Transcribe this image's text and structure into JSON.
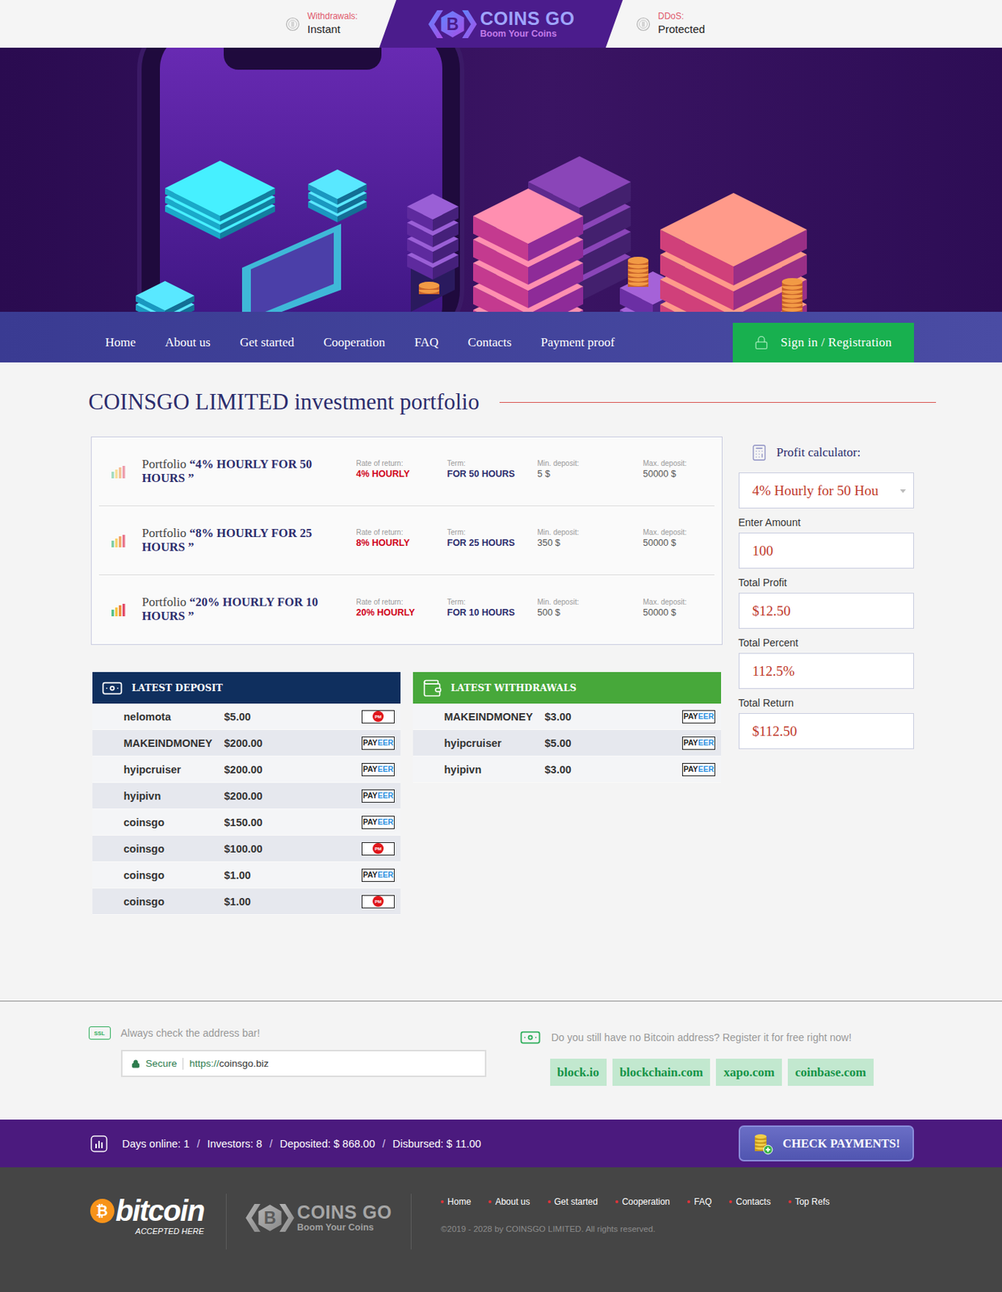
{
  "header": {
    "withdrawals": {
      "label": "Withdrawals:",
      "value": "Instant"
    },
    "ddos": {
      "label": "DDoS:",
      "value": "Protected"
    }
  },
  "logo": {
    "mark": "B",
    "name": "COINS GO",
    "tagline": "Boom Your Coins"
  },
  "nav": {
    "items": [
      "Home",
      "About us",
      "Get started",
      "Cooperation",
      "FAQ",
      "Contacts",
      "Payment proof"
    ],
    "sign_in": "Sign in / Registration"
  },
  "portfolio": {
    "title": "COINSGO LIMITED investment portfolio",
    "prefix": "Portfolio",
    "plans": [
      {
        "name": "“4% HOURLY FOR 50 HOURS ”",
        "rate_label": "Rate of return:",
        "rate": "4% HOURLY",
        "term_label": "Term:",
        "term": "FOR 50 HOURS",
        "min_label": "Min. deposit:",
        "min": "5 $",
        "max_label": "Max. deposit:",
        "max": "50000 $",
        "level": 0.33
      },
      {
        "name": "“8% HOURLY FOR 25 HOURS ”",
        "rate_label": "Rate of return:",
        "rate": "8% HOURLY",
        "term_label": "Term:",
        "term": "FOR 25 HOURS",
        "min_label": "Min. deposit:",
        "min": "350 $",
        "max_label": "Max. deposit:",
        "max": "50000 $",
        "level": 0.66
      },
      {
        "name": "“20% HOURLY FOR 10 HOURS ”",
        "rate_label": "Rate of return:",
        "rate": "20% HOURLY",
        "term_label": "Term:",
        "term": "FOR 10 HOURS",
        "min_label": "Min. deposit:",
        "min": "500 $",
        "max_label": "Max. deposit:",
        "max": "50000 $",
        "level": 1
      }
    ]
  },
  "calculator": {
    "title": "Profit calculator:",
    "plan": "4% Hourly for 50 Hou",
    "fields": [
      {
        "label": "Enter Amount",
        "value": "100"
      },
      {
        "label": "Total Profit",
        "value": "$12.50"
      },
      {
        "label": "Total Percent",
        "value": "112.5%"
      },
      {
        "label": "Total Return",
        "value": "$112.50"
      }
    ]
  },
  "payment_badges": {
    "payeer": [
      "PAY",
      "EER"
    ],
    "pm": "PM"
  },
  "deposits": {
    "title": "LATEST DEPOSIT",
    "rows": [
      {
        "name": "nelomota",
        "amount": "$5.00",
        "kind": "pm"
      },
      {
        "name": "MAKEINDMONEY",
        "amount": "$200.00",
        "kind": "payeer"
      },
      {
        "name": "hyipcruiser",
        "amount": "$200.00",
        "kind": "payeer"
      },
      {
        "name": "hyipivn",
        "amount": "$200.00",
        "kind": "payeer"
      },
      {
        "name": "coinsgo",
        "amount": "$150.00",
        "kind": "payeer"
      },
      {
        "name": "coinsgo",
        "amount": "$100.00",
        "kind": "pm"
      },
      {
        "name": "coinsgo",
        "amount": "$1.00",
        "kind": "payeer"
      },
      {
        "name": "coinsgo",
        "amount": "$1.00",
        "kind": "pm"
      }
    ]
  },
  "withdrawals": {
    "title": "LATEST WITHDRAWALS",
    "rows": [
      {
        "name": "MAKEINDMONEY",
        "amount": "$3.00",
        "kind": "payeer"
      },
      {
        "name": "hyipcruiser",
        "amount": "$5.00",
        "kind": "payeer"
      },
      {
        "name": "hyipivn",
        "amount": "$3.00",
        "kind": "payeer"
      }
    ]
  },
  "notices": {
    "address": "Always check the address bar!",
    "ssl": "SSL",
    "secure": "Secure",
    "url_scheme": "https://",
    "url_host": "coinsgo.biz",
    "bitcoin": "Do you still have no Bitcoin address? Register it for free right now!",
    "wallets": [
      "block.io",
      "blockchain.com",
      "xapo.com",
      "coinbase.com"
    ]
  },
  "stats": {
    "items": [
      "Days online: 1",
      "Investors: 8",
      "Deposited: $ 868.00",
      "Disbursed: $ 11.00"
    ],
    "separator": "/",
    "check": "CHECK PAYMENTS!"
  },
  "footer": {
    "bitcoin": {
      "symbol": "₿",
      "word": "bitcoin",
      "note": "ACCEPTED HERE"
    },
    "links": [
      "Home",
      "About us",
      "Get started",
      "Cooperation",
      "FAQ",
      "Contacts",
      "Top Refs"
    ],
    "copyright": "©2019 - 2028 by COINSGO LIMITED. All rights reserved."
  }
}
